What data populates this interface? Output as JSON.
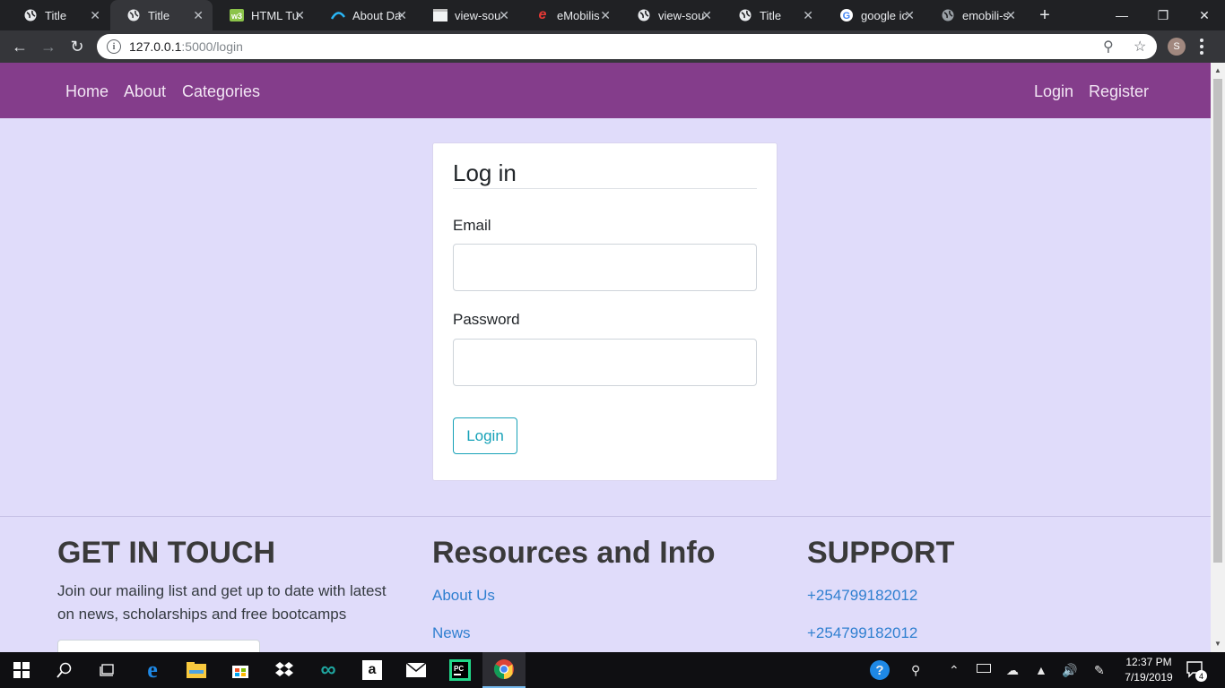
{
  "browser": {
    "tabs": [
      {
        "title": "Title",
        "icon": "globe-icon",
        "active": false
      },
      {
        "title": "Title",
        "icon": "globe-icon",
        "active": true
      },
      {
        "title": "HTML Tu",
        "icon": "w3schools-icon",
        "active": false
      },
      {
        "title": "About Da",
        "icon": "wave-icon",
        "active": false
      },
      {
        "title": "view-sou",
        "icon": "blank-page-icon",
        "active": false
      },
      {
        "title": "eMobilis",
        "icon": "emobilis-icon",
        "active": false
      },
      {
        "title": "view-sou",
        "icon": "globe-icon",
        "active": false
      },
      {
        "title": "Title",
        "icon": "globe-icon",
        "active": false
      },
      {
        "title": "google ic",
        "icon": "google-icon",
        "active": false
      },
      {
        "title": "emobili-s",
        "icon": "globe-icon",
        "active": false
      }
    ],
    "url_host": "127.0.0.1",
    "url_path": ":5000/login",
    "profile_initial": "S"
  },
  "nav": {
    "left": [
      "Home",
      "About",
      "Categories"
    ],
    "right": [
      "Login",
      "Register"
    ],
    "color": "#843d8b"
  },
  "login": {
    "title": "Log in",
    "email_label": "Email",
    "email_value": "",
    "password_label": "Password",
    "password_value": "",
    "button": "Login",
    "button_color": "#17a2b8"
  },
  "footer": {
    "touch": {
      "heading": "GET IN TOUCH",
      "text": "Join our mailing list and get up to date with latest on news, scholarships and free bootcamps"
    },
    "resources": {
      "heading": "Resources and Info",
      "links": [
        "About Us",
        "News"
      ]
    },
    "support": {
      "heading": "SUPPORT",
      "links": [
        "+254799182012",
        "+254799182012"
      ]
    }
  },
  "page_background": "#e0dcfa",
  "taskbar": {
    "time": "12:37 PM",
    "date": "7/19/2019",
    "notifications": "4"
  }
}
